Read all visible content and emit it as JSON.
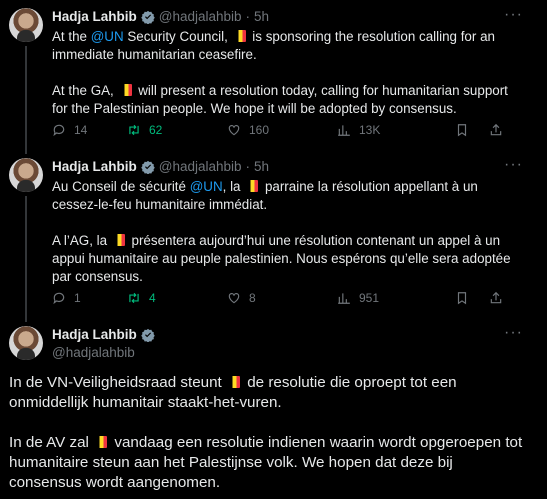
{
  "tweets": [
    {
      "name": "Hadja Lahbib",
      "handle": "@hadjalahbib",
      "dot": "·",
      "time": "5h",
      "p1": [
        "At the ",
        "@UN",
        " Security Council, ",
        " is sponsoring the resolution calling for an immediate humanitarian ceasefire."
      ],
      "p2": [
        "At the GA, ",
        " will present a resolution today, calling for humanitarian support for the Palestinian people. We hope it will be adopted by consensus."
      ],
      "replies": "14",
      "retweets": "62",
      "likes": "160",
      "views": "13K"
    },
    {
      "name": "Hadja Lahbib",
      "handle": "@hadjalahbib",
      "dot": "·",
      "time": "5h",
      "p1": [
        "Au Conseil de sécurité ",
        "@UN",
        ", la ",
        " parraine la résolution appellant à un cessez-le-feu humanitaire immédiat."
      ],
      "p2": [
        "A l’AG, la ",
        " présentera aujourd’hui une résolution  contenant un appel à un appui humanitaire au peuple palestinien. Nous espérons qu’elle sera  adoptée par consensus."
      ],
      "replies": "1",
      "retweets": "4",
      "likes": "8",
      "views": "951"
    }
  ],
  "main_tweet": {
    "name": "Hadja Lahbib",
    "handle": "@hadjalahbib",
    "p1": [
      "In de VN-Veiligheidsraad steunt ",
      " de resolutie die oproept tot een onmiddellijk humanitair staakt-het-vuren."
    ],
    "p2": [
      "In de AV zal ",
      " vandaag een resolutie indienen waarin wordt opgeroepen tot humanitaire steun aan het Palestijnse volk. We hopen dat deze bij consensus wordt aangenomen."
    ]
  },
  "icons": {
    "verified": "verified-badge-icon",
    "more": "more-icon",
    "reply": "reply-icon",
    "retweet": "retweet-icon",
    "like": "like-icon",
    "views": "views-icon",
    "bookmark": "bookmark-icon",
    "share": "share-icon",
    "flag": "belgium-flag-icon"
  },
  "colors": {
    "background": "#000000",
    "text": "#e7e9ea",
    "muted": "#71767b",
    "accent": "#1d9bf0",
    "retweet": "#00ba7c"
  },
  "more_label": "···"
}
